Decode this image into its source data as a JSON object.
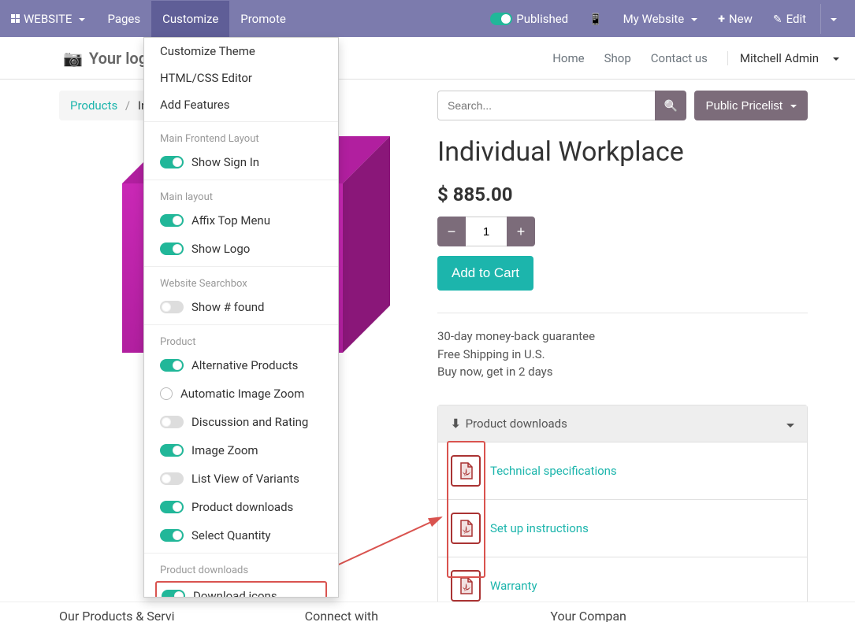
{
  "topbar": {
    "website_label": "WEBSITE",
    "pages_label": "Pages",
    "customize_label": "Customize",
    "promote_label": "Promote",
    "published_label": "Published",
    "my_website_label": "My Website",
    "new_label": "New",
    "edit_label": "Edit"
  },
  "header": {
    "logo_text": "Your logo",
    "nav": {
      "home": "Home",
      "shop": "Shop",
      "contact": "Contact us"
    },
    "user": "Mitchell Admin"
  },
  "dropdown": {
    "items_top": [
      "Customize Theme",
      "HTML/CSS Editor",
      "Add Features"
    ],
    "sections": [
      {
        "header": "Main Frontend Layout",
        "toggles": [
          {
            "label": "Show Sign In",
            "on": true
          }
        ]
      },
      {
        "header": "Main layout",
        "toggles": [
          {
            "label": "Affix Top Menu",
            "on": true
          },
          {
            "label": "Show Logo",
            "on": true
          }
        ]
      },
      {
        "header": "Website Searchbox",
        "toggles": [
          {
            "label": "Show # found",
            "on": false
          }
        ]
      },
      {
        "header": "Product",
        "toggles": [
          {
            "label": "Alternative Products",
            "on": true
          },
          {
            "label": "Automatic Image Zoom",
            "radio": true
          },
          {
            "label": "Discussion and Rating",
            "on": false
          },
          {
            "label": "Image Zoom",
            "on": true
          },
          {
            "label": "List View of Variants",
            "on": false
          },
          {
            "label": "Product downloads",
            "on": true
          },
          {
            "label": "Select Quantity",
            "on": true
          }
        ]
      },
      {
        "header": "Product downloads",
        "toggles": [
          {
            "label": "Download icons",
            "on": true,
            "highlight": true
          }
        ]
      }
    ]
  },
  "breadcrumb": {
    "products": "Products",
    "current": "Ind"
  },
  "search": {
    "placeholder": "Search..."
  },
  "pricelist": "Public Pricelist",
  "product": {
    "title": "Individual Workplace",
    "price": "$ 885.00",
    "qty": "1",
    "add_to_cart": "Add to Cart",
    "info": [
      "30-day money-back guarantee",
      "Free Shipping in U.S.",
      "Buy now, get in 2 days"
    ]
  },
  "downloads": {
    "header": "Product downloads",
    "items": [
      "Technical specifications",
      "Set up instructions",
      "Warranty"
    ]
  },
  "footer": {
    "col1": "Our Products & Servi",
    "col2": "Connect with",
    "col3": "Your Compan"
  }
}
